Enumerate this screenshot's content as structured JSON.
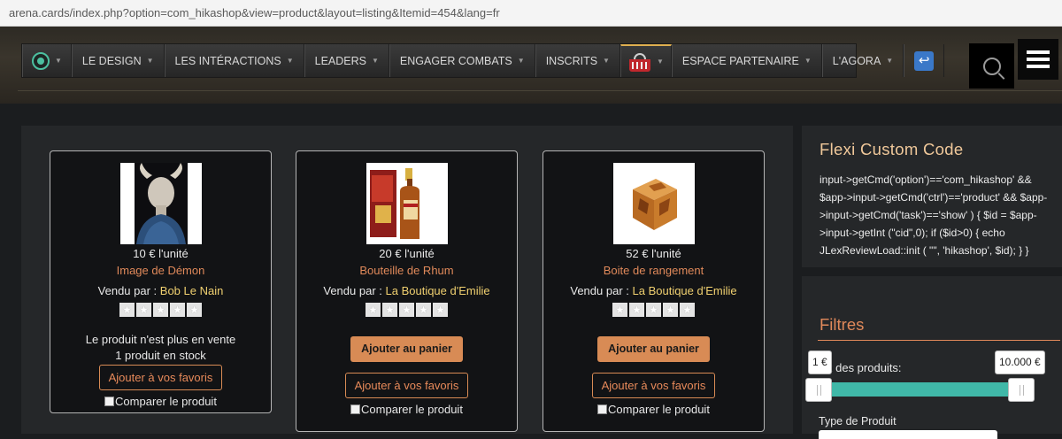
{
  "browser": {
    "url": "arena.cards/index.php?option=com_hikashop&view=product&layout=listing&Itemid=454&lang=fr"
  },
  "nav": {
    "items": [
      {
        "label": "LE DESIGN"
      },
      {
        "label": "LES INTÉRACTIONS"
      },
      {
        "label": "LEADERS"
      },
      {
        "label": "ENGAGER COMBATS"
      },
      {
        "label": "INSCRITS"
      },
      {
        "label": "ESPACE PARTENAIRE"
      },
      {
        "label": "L'AGORA"
      }
    ],
    "caret": "▼",
    "logout_glyph": "↩",
    "icons": [
      "eye-icon",
      "basket-icon",
      "logout-icon",
      "search-icon",
      "hamburger-menu-icon"
    ],
    "accent": "#e0b050"
  },
  "products": [
    {
      "price": "10 € l'unité",
      "name": "Image de Démon",
      "seller_prefix": "Vendu par : ",
      "seller": "Bob Le Nain",
      "stock_line1": "Le produit n'est plus en vente",
      "stock_line2": "1 produit en stock",
      "fav_label": "Ajouter à vos favoris",
      "compare_label": "Comparer le produit"
    },
    {
      "price": "20 € l'unité",
      "name": "Bouteille de Rhum",
      "seller_prefix": "Vendu par : ",
      "seller": "La Boutique d'Emilie",
      "cart_label": "Ajouter au panier",
      "fav_label": "Ajouter à vos favoris",
      "compare_label": "Comparer le produit"
    },
    {
      "price": "52 € l'unité",
      "name": "Boite de rangement",
      "seller_prefix": "Vendu par : ",
      "seller": "La Boutique d'Emilie",
      "cart_label": "Ajouter au panier",
      "fav_label": "Ajouter à vos favoris",
      "compare_label": "Comparer le produit"
    }
  ],
  "rating_star": "★",
  "sidebar": {
    "custom_code_title": "Flexi Custom Code",
    "custom_code_text": "input->getCmd('option')=='com_hikashop' && $app->input->getCmd('ctrl')=='product' && $app->input->getCmd('task')=='show' ) { $id = $app->input->getInt (\"cid\",0); if ($id>0) { echo JLexReviewLoad::init ( \"\", 'hikashop', $id); } }",
    "filters_title": "Filtres",
    "price_label": "x des produits:",
    "price_min": "1 €",
    "price_max": "10.000 €",
    "type_label": "Type de Produit"
  },
  "colors": {
    "accent_orange": "#d88b55",
    "seller_yellow": "#f0d070",
    "slider_teal": "#40b8a8"
  }
}
